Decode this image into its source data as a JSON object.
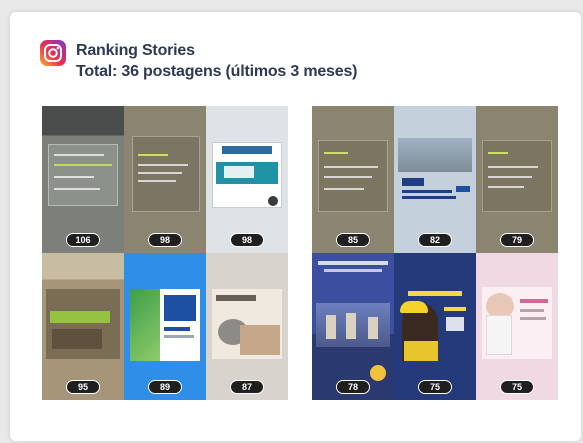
{
  "header": {
    "title": "Ranking Stories",
    "subtitle": "Total: 36 postagens (últimos 3 meses)"
  },
  "left_group": {
    "stories": [
      {
        "count": "106",
        "bg": "#7d7f7a"
      },
      {
        "count": "98",
        "bg": "#8b8470"
      },
      {
        "count": "98",
        "bg": "#e0e3e6"
      },
      {
        "count": "95",
        "bg": "#a69578"
      },
      {
        "count": "89",
        "bg": "#2f8fe8"
      },
      {
        "count": "87",
        "bg": "#d9d3cd"
      }
    ]
  },
  "right_group": {
    "stories": [
      {
        "count": "85",
        "bg": "#8a8470"
      },
      {
        "count": "82",
        "bg": "#c4d1dd"
      },
      {
        "count": "79",
        "bg": "#8a8470"
      },
      {
        "count": "78",
        "bg": "#3b4ea0"
      },
      {
        "count": "75",
        "bg": "#243a7a"
      },
      {
        "count": "75",
        "bg": "#f0d9e2"
      }
    ]
  }
}
